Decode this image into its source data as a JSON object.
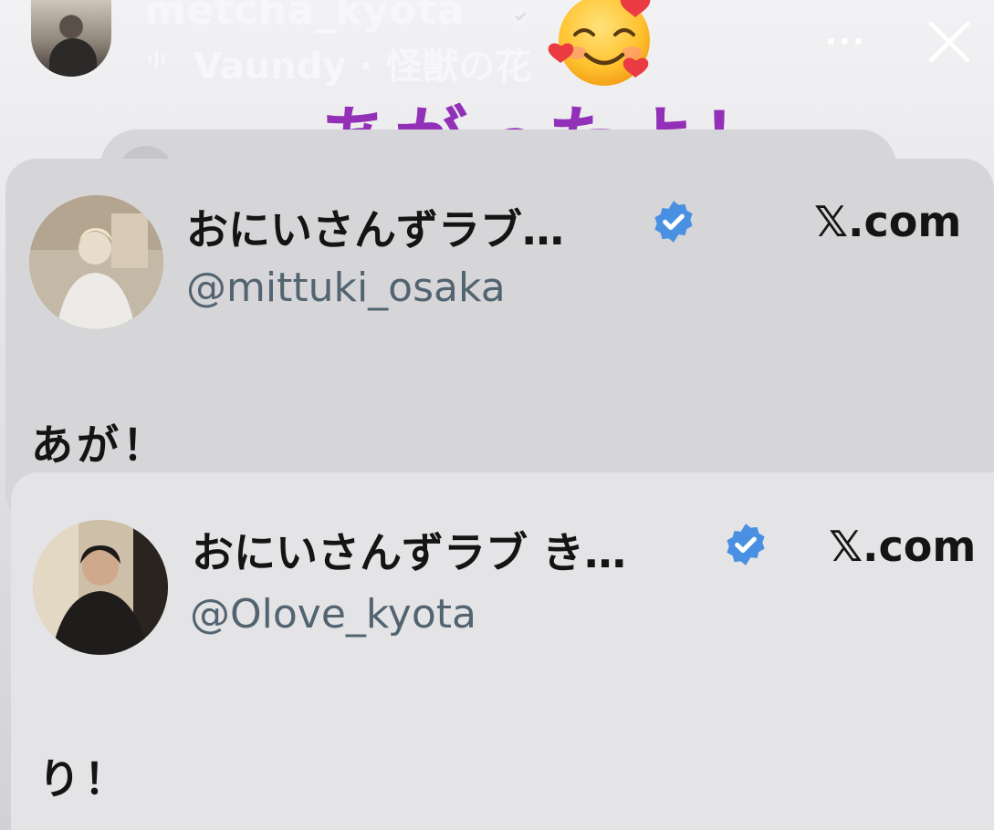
{
  "story": {
    "username": "metcha_kyota",
    "music": "Vaundy · 怪獣の花",
    "more_label": "···",
    "sticker_text": "あがったよ！"
  },
  "cards": [
    {
      "display_name": "おにいさんずラブ…",
      "handle": "@mittuki_osaka",
      "source": "𝕏.com",
      "text": "あが！"
    },
    {
      "display_name": "おにいさんずラブ き…",
      "handle": "@Olove_kyota",
      "source": "𝕏.com",
      "text": "り！"
    }
  ],
  "colors": {
    "sticker_purple": "#9230b8",
    "verified_blue": "#4a90e2",
    "handle_gray": "#536471"
  },
  "icons": {
    "verified": "verified-badge-icon",
    "music": "music-waveform-icon",
    "close": "close-icon",
    "emoji": "smiling-face-with-hearts-emoji"
  }
}
